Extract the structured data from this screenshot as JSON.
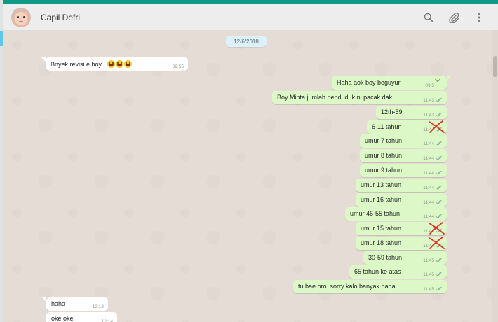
{
  "header": {
    "contact_name": "Capil Defri",
    "icons": [
      "search-icon",
      "attach-icon",
      "menu-icon"
    ]
  },
  "date_label": "12/6/2018",
  "incoming_top": {
    "text": "Bnyek revisi e boy...",
    "emoji_count": 3,
    "time": "09:55"
  },
  "outgoing": [
    {
      "text": "Haha aok boy beguyur",
      "time": "09:5"
    },
    {
      "text": "Boy Minta jumlah penduduk ni pacak dak",
      "time": "11:43"
    },
    {
      "text": "12th-59",
      "time": "11:43"
    },
    {
      "text": "6-11 tahun",
      "time": "11:44",
      "crossed": true
    },
    {
      "text": "umur 7 tahun",
      "time": "11:44"
    },
    {
      "text": "umur 8 tahun",
      "time": "11:44"
    },
    {
      "text": "umur 9 tahun",
      "time": "11:44"
    },
    {
      "text": "umur 13 tahun",
      "time": "11:44"
    },
    {
      "text": "umur 16 tahun",
      "time": "11:44"
    },
    {
      "text": "umur 46-55 tahun",
      "time": "11:44"
    },
    {
      "text": "umur 15 tahun",
      "time": "11:44",
      "crossed": true
    },
    {
      "text": "umur 18 tahun",
      "time": "11:44",
      "crossed": true
    },
    {
      "text": "30-59 tahun",
      "time": "11:45"
    },
    {
      "text": "65 tahun ke atas",
      "time": "11:45"
    },
    {
      "text": "tu bae bro. sorry kalo banyak haha",
      "time": "11:45"
    }
  ],
  "incoming_bottom": [
    {
      "text": "haha",
      "time": "12:13"
    },
    {
      "text": "oke oke",
      "time": "12:14"
    }
  ],
  "colors": {
    "app_bar": "#0e9a86",
    "chat_bg": "#e5ddd5",
    "outgoing_bubble": "#dcf8c6",
    "incoming_bubble": "#ffffff",
    "read_ticks": "#8fb0a0",
    "cross_mark": "#e0322d"
  }
}
